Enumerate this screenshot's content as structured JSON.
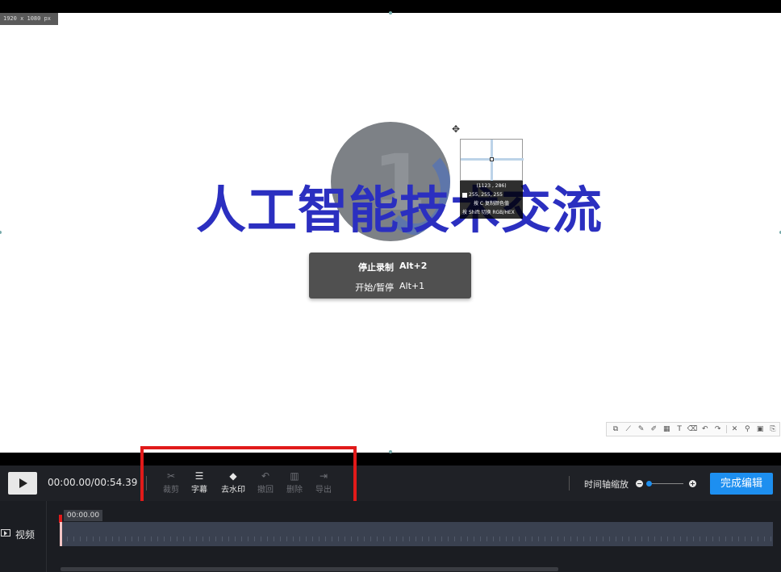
{
  "preview": {
    "dimension_label": "1920 x 1080 px",
    "headline": "人工智能技术交流",
    "logo_digit": "1"
  },
  "color_picker": {
    "coords": "(1123 , 286)",
    "rgb": "255, 255, 255",
    "hint_copy": "按 C 复制颜色值",
    "hint_shift": "按 Shift 切换 RGB/HEX"
  },
  "shortcut_popup": {
    "stop": {
      "name": "停止录制",
      "key": "Alt+2"
    },
    "pause": {
      "name": "开始/暂停",
      "key": "Alt+1"
    }
  },
  "mini_toolbar": {
    "icons": [
      "crop-icon",
      "line-icon",
      "pen-icon",
      "highlighter-icon",
      "mosaic-icon",
      "text-icon",
      "eraser-icon",
      "undo-icon",
      "redo-icon",
      "close-icon",
      "pin-icon",
      "save-icon",
      "copy-icon"
    ],
    "glyphs": [
      "⧉",
      "⟋",
      "✎",
      "✐",
      "▦",
      "T",
      "⌫",
      "↶",
      "↷",
      "✕",
      "⚲",
      "▣",
      "⎘"
    ]
  },
  "controls": {
    "timecode": "00:00.00/00:54.39",
    "tools": [
      {
        "label": "裁剪",
        "glyph": "✂",
        "enabled": false
      },
      {
        "label": "字幕",
        "glyph": "☰",
        "enabled": true
      },
      {
        "label": "去水印",
        "glyph": "◆",
        "enabled": true
      },
      {
        "label": "撤回",
        "glyph": "↶",
        "enabled": false
      },
      {
        "label": "删除",
        "glyph": "▥",
        "enabled": false
      },
      {
        "label": "导出",
        "glyph": "⇥",
        "enabled": false
      }
    ],
    "zoom_label": "时间轴缩放",
    "zoom_minus": "−",
    "zoom_plus": "+",
    "done_label": "完成编辑"
  },
  "timeline": {
    "track_label": "视频",
    "playhead_time": "00:00.00"
  },
  "colors": {
    "accent": "#1d8ff0",
    "headline": "#2b2fc0",
    "highlight_box": "#e11a1a"
  }
}
